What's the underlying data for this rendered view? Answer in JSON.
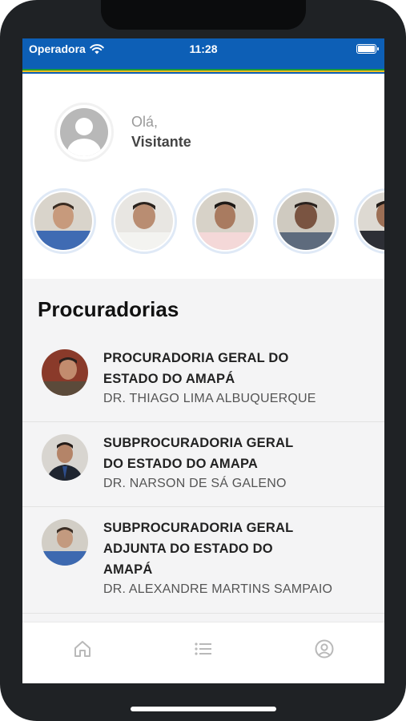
{
  "status_bar": {
    "carrier": "Operadora",
    "time": "11:28"
  },
  "flag_colors": [
    "#1a9a3a",
    "#f2c01e",
    "#0d5fb6",
    "#ffffff"
  ],
  "greeting": {
    "line1": "Olá,",
    "line2": "Visitante"
  },
  "section": {
    "title": "Procuradorias",
    "items": [
      {
        "title_lines": [
          "PROCURADORIA GERAL DO",
          "ESTADO DO AMAPÁ"
        ],
        "subtitle": "DR. THIAGO LIMA ALBUQUERQUE"
      },
      {
        "title_lines": [
          "SUBPROCURADORIA GERAL",
          "DO ESTADO DO AMAPA"
        ],
        "subtitle": "DR. NARSON DE SÁ GALENO"
      },
      {
        "title_lines": [
          "SUBPROCURADORIA GERAL",
          "ADJUNTA DO ESTADO DO",
          "AMAPÁ"
        ],
        "subtitle": "DR. ALEXANDRE MARTINS SAMPAIO"
      }
    ]
  },
  "tabs": [
    {
      "icon": "home-icon"
    },
    {
      "icon": "list-icon"
    },
    {
      "icon": "profile-icon"
    }
  ],
  "colors": {
    "status_bar": "#0d5fb6",
    "section_bg": "#f4f4f5",
    "tab_icon": "#b9b9b9"
  }
}
